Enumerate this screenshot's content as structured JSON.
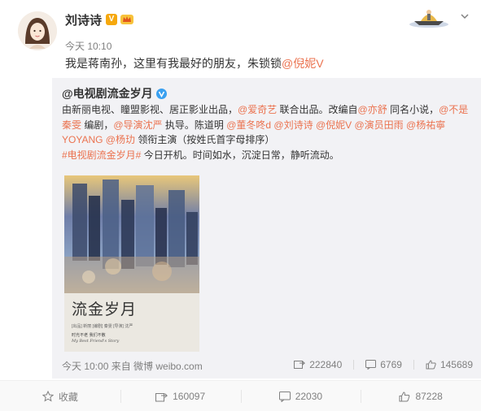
{
  "post": {
    "author": "刘诗诗",
    "vip_mark": "V",
    "time": "今天 10:10",
    "text_prefix": "我是蒋南孙，这里有我最好的朋友，朱锁锁",
    "mention": "@倪妮V"
  },
  "repost": {
    "author": "@电视剧流金岁月",
    "line1_text": "由新丽电视、瞳盟影视、居正影业出品，",
    "line1_link": "@爱奇艺",
    "line1_text2": " 联合出品。改编自",
    "line1_link2": "@亦舒",
    "line1_text3": " 同名小说，",
    "line1_link3": "@不是",
    "line2_link": "秦雯",
    "line2_text": " 编剧，",
    "line2_link2": "@导演沈严",
    "line2_text2": " 执导。陈道明 ",
    "line2_link3": "@董冬咚d",
    "line2_link4": " @刘诗诗",
    "line2_link5": " @倪妮V",
    "line2_link6": " @演员田雨",
    "line2_link7": " @杨祐寧",
    "line3_link": "YOYANG",
    "line3_link2": " @杨玏",
    "line3_text": " 领衔主演（按姓氏首字母排序）",
    "line4_link": "#电视剧流金岁月#",
    "line4_text": " 今日开机。时间如水，沉淀日常，静听流动。",
    "poster": {
      "title": "流金岁月",
      "credit": "[出品]  新丽  [编剧] 秦雯     [导演] 沈严",
      "tagline": "时光不老  我们不散",
      "tagline_en": "My Best Friend's Story"
    },
    "meta": "今天 10:00 来自 微博 weibo.com",
    "reposts": "222840",
    "comments": "6769",
    "likes": "145689"
  },
  "actions": {
    "favorite": "收藏",
    "forward": "160097",
    "comment": "22030",
    "like": "87228"
  },
  "colors": {
    "link": "#eb7350",
    "verify_blue": "#3aa0f0",
    "vip_orange": "#f6a80d"
  }
}
